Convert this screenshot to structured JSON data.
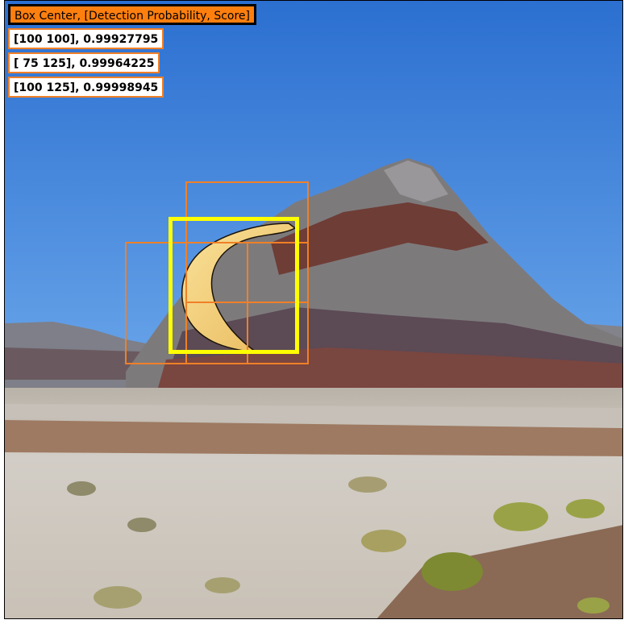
{
  "legend": {
    "header": "Box Center,    [Detection Probability, Score]",
    "rows": [
      {
        "text": "[100 100],   0.99927795"
      },
      {
        "text": "[ 75 125],   0.99964225"
      },
      {
        "text": "[100 125],   0.99998945"
      }
    ]
  },
  "colors": {
    "header_fill": "#ff7f0e",
    "header_border": "#000000",
    "detection_box": "#f08028",
    "highlight_box": "#ffff00",
    "sky": "#2f7fd9",
    "banana": "#f6d57a"
  },
  "scene": {
    "subject": "banana",
    "background": "desert mountain"
  }
}
